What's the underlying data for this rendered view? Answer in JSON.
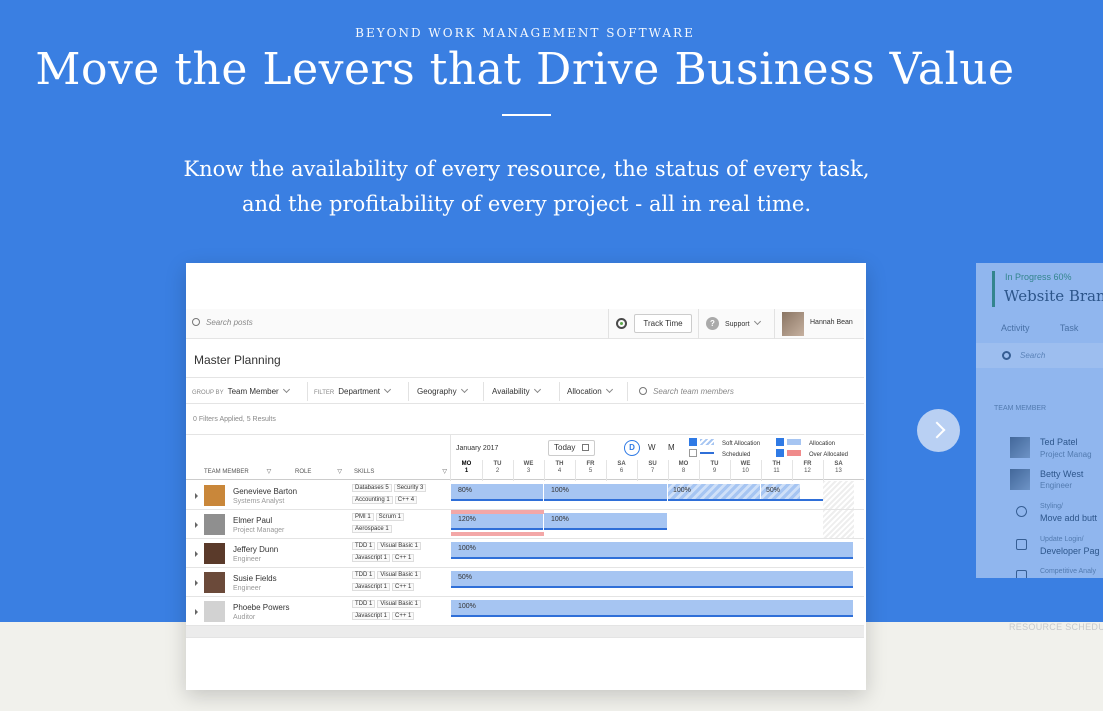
{
  "hero": {
    "eyebrow": "BEYOND WORK MANAGEMENT SOFTWARE",
    "title": "Move the Levers that Drive Business Value",
    "subtitle_line1": "Know the availability of every resource, the status of every task,",
    "subtitle_line2": "and the profitability of every project - all in real time.",
    "accent_color": "#3a7fe2"
  },
  "app": {
    "search_placeholder": "Search posts",
    "track_time": "Track Time",
    "help_icon": "?",
    "support": "Support",
    "user": "Hannah Bean",
    "page_title": "Master Planning",
    "filters": {
      "group_by_label": "GROUP BY",
      "group_by_value": "Team Member",
      "filter_label": "FILTER",
      "department": "Department",
      "geography": "Geography",
      "availability": "Availability",
      "allocation": "Allocation",
      "search_team": "Search team members"
    },
    "results": "0 Filters Applied, 5 Results",
    "columns": {
      "team_member": "TEAM MEMBER",
      "role": "ROLE",
      "skills": "SKILLS"
    },
    "calendar": {
      "month": "January 2017",
      "today": "Today",
      "view_d": "D",
      "view_w": "W",
      "view_m": "M",
      "legend": {
        "soft_allocation": "Soft Allocation",
        "scheduled": "Scheduled",
        "allocation": "Allocation",
        "over_allocated": "Over Allocated"
      },
      "days": [
        {
          "d": "MO",
          "n": "1"
        },
        {
          "d": "TU",
          "n": "2"
        },
        {
          "d": "WE",
          "n": "3"
        },
        {
          "d": "TH",
          "n": "4"
        },
        {
          "d": "FR",
          "n": "5"
        },
        {
          "d": "SA",
          "n": "6"
        },
        {
          "d": "SU",
          "n": "7"
        },
        {
          "d": "MO",
          "n": "8"
        },
        {
          "d": "TU",
          "n": "9"
        },
        {
          "d": "WE",
          "n": "10"
        },
        {
          "d": "TH",
          "n": "11"
        },
        {
          "d": "FR",
          "n": "12"
        },
        {
          "d": "SA",
          "n": "13"
        }
      ]
    },
    "members": [
      {
        "name": "Genevieve Barton",
        "role": "Systems Analyst",
        "skills1": [
          [
            "Databases",
            "5"
          ],
          [
            "Security",
            "3"
          ]
        ],
        "skills2": [
          [
            "Accounting",
            "1"
          ],
          [
            "C++",
            "4"
          ]
        ],
        "allocations": [
          "80%",
          "100%",
          "100%",
          "50%"
        ]
      },
      {
        "name": "Elmer Paul",
        "role": "Project Manager",
        "skills1": [
          [
            "PMI",
            "1"
          ],
          [
            "Scrum",
            "1"
          ]
        ],
        "skills2": [
          [
            "Aerospace",
            "1"
          ]
        ],
        "allocations": [
          "120%",
          "100%"
        ]
      },
      {
        "name": "Jeffery Dunn",
        "role": "Engineer",
        "skills1": [
          [
            "TDD",
            "1"
          ],
          [
            "Visual Basic",
            "1"
          ]
        ],
        "skills2": [
          [
            "Javascript",
            "1"
          ],
          [
            "C++",
            "1"
          ]
        ],
        "allocations": [
          "100%"
        ]
      },
      {
        "name": "Susie Fields",
        "role": "Engineer",
        "skills1": [
          [
            "TDD",
            "1"
          ],
          [
            "Visual Basic",
            "1"
          ]
        ],
        "skills2": [
          [
            "Javascript",
            "1"
          ],
          [
            "C++",
            "1"
          ]
        ],
        "allocations": [
          "50%"
        ]
      },
      {
        "name": "Phoebe Powers",
        "role": "Auditor",
        "skills1": [
          [
            "TDD",
            "1"
          ],
          [
            "Visual Basic",
            "1"
          ]
        ],
        "skills2": [
          [
            "Javascript",
            "1"
          ],
          [
            "C++",
            "1"
          ]
        ],
        "allocations": [
          "100%"
        ]
      }
    ]
  },
  "next_card": {
    "status": "In Progress",
    "percent": "60%",
    "title": "Website Brand",
    "tab1": "Activity",
    "tab2": "Task Track",
    "search": "Search",
    "section": "TEAM MEMBER",
    "person1_name": "Ted Patel",
    "person1_role": "Project Manag",
    "person2_name": "Betty West",
    "person2_role": "Engineer",
    "task1_sub": "Styling/",
    "task1": "Move add butt",
    "task2_sub": "Update Login/",
    "task2": "Developer Pag",
    "task3_sub": "Competitive Analy",
    "caption": "RESOURCE SCHEDU"
  }
}
